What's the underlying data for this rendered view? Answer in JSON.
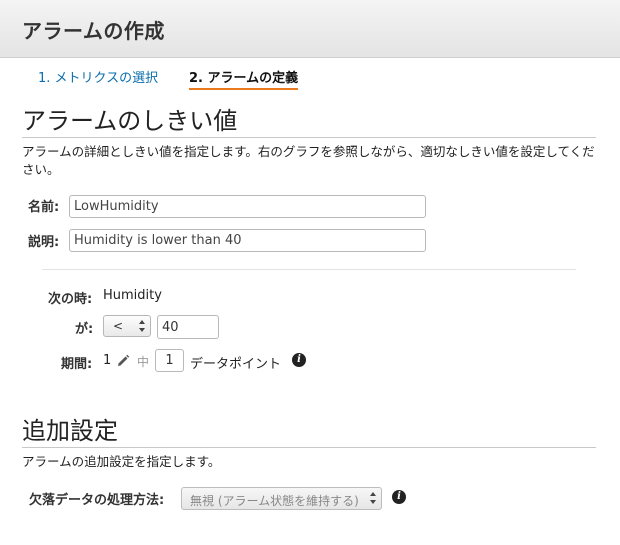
{
  "header": {
    "title": "アラームの作成"
  },
  "steps": [
    {
      "label": "1. メトリクスの選択",
      "active": false
    },
    {
      "label": "2. アラームの定義",
      "active": true
    }
  ],
  "threshold_section": {
    "title": "アラームのしきい値",
    "description": "アラームの詳細としきい値を指定します。右のグラフを参照しながら、適切なしきい値を設定してください。",
    "name_label": "名前:",
    "name_value": "LowHumidity",
    "desc_label": "説明:",
    "desc_value": "Humidity is lower than 40"
  },
  "condition": {
    "when_label": "次の時:",
    "when_value": "Humidity",
    "ga_label": "が:",
    "operator": "<",
    "threshold": "40",
    "period_label": "期間:",
    "period_value": "1",
    "middle_word": "中",
    "datapoints": "1",
    "datapoints_label": "データポイント"
  },
  "additional_section": {
    "title": "追加設定",
    "description": "アラームの追加設定を指定します。",
    "missing_label": "欠落データの処理方法:",
    "missing_value": "無視 (アラーム状態を維持する)"
  },
  "icons": {
    "info": "info-icon",
    "edit": "pencil-icon",
    "select_arrows": "updown-arrows-icon"
  },
  "colors": {
    "link": "#0b6ead",
    "active_step_underline": "#e8791d"
  }
}
